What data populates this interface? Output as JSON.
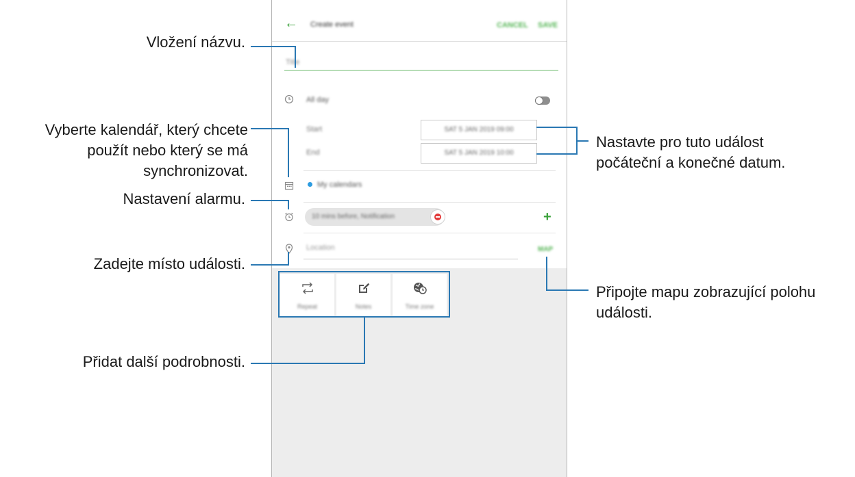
{
  "app": {
    "header": {
      "title": "Create event",
      "cancel_label": "CANCEL",
      "save_label": "SAVE"
    },
    "title_placeholder": "Title",
    "all_day_label": "All day",
    "start": {
      "label": "Start",
      "value": "SAT 5 JAN 2019 09:00"
    },
    "end": {
      "label": "End",
      "value": "SAT 5 JAN 2019 10:00"
    },
    "calendar_name": "My calendars",
    "alarm": {
      "text": "10 mins before, Notification"
    },
    "location": {
      "placeholder": "Location",
      "map_label": "MAP"
    },
    "details": [
      {
        "label": "Repeat",
        "icon": "repeat-icon"
      },
      {
        "label": "Notes",
        "icon": "notes-icon"
      },
      {
        "label": "Time zone",
        "icon": "time-zone-icon"
      }
    ]
  },
  "callouts": {
    "title": "Vložení názvu.",
    "calendar": [
      "Vyberte kalendář, který chcete",
      "použít nebo který se má",
      "synchronizovat."
    ],
    "alarm": "Nastavení alarmu.",
    "location": "Zadejte místo události.",
    "details": "Přidat další podrobnosti.",
    "dates": [
      "Nastavte pro tuto událost",
      "počáteční a konečné datum."
    ],
    "map": [
      "Připojte mapu zobrazující polohu",
      "události."
    ]
  },
  "colors": {
    "accent_green": "#3ba23b",
    "callout_line": "#2a78b3",
    "calendar_dot": "#2d9ce0",
    "remove_red": "#e33c3c"
  }
}
